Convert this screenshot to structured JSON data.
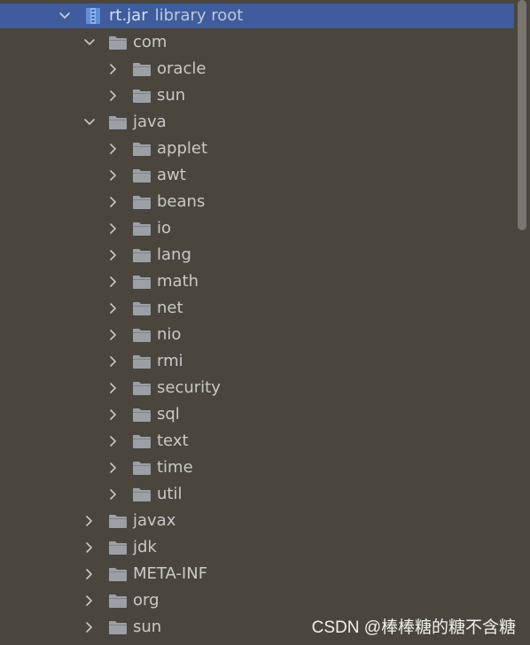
{
  "tree": {
    "root": {
      "label": "rt.jar",
      "secondary": "library root",
      "expanded": true
    },
    "items": [
      {
        "label": "com",
        "expanded": true,
        "depth": 1
      },
      {
        "label": "oracle",
        "expanded": false,
        "depth": 2
      },
      {
        "label": "sun",
        "expanded": false,
        "depth": 2
      },
      {
        "label": "java",
        "expanded": true,
        "depth": 1
      },
      {
        "label": "applet",
        "expanded": false,
        "depth": 2
      },
      {
        "label": "awt",
        "expanded": false,
        "depth": 2
      },
      {
        "label": "beans",
        "expanded": false,
        "depth": 2
      },
      {
        "label": "io",
        "expanded": false,
        "depth": 2
      },
      {
        "label": "lang",
        "expanded": false,
        "depth": 2
      },
      {
        "label": "math",
        "expanded": false,
        "depth": 2
      },
      {
        "label": "net",
        "expanded": false,
        "depth": 2
      },
      {
        "label": "nio",
        "expanded": false,
        "depth": 2
      },
      {
        "label": "rmi",
        "expanded": false,
        "depth": 2
      },
      {
        "label": "security",
        "expanded": false,
        "depth": 2
      },
      {
        "label": "sql",
        "expanded": false,
        "depth": 2
      },
      {
        "label": "text",
        "expanded": false,
        "depth": 2
      },
      {
        "label": "time",
        "expanded": false,
        "depth": 2
      },
      {
        "label": "util",
        "expanded": false,
        "depth": 2
      },
      {
        "label": "javax",
        "expanded": false,
        "depth": 1
      },
      {
        "label": "jdk",
        "expanded": false,
        "depth": 1
      },
      {
        "label": "META-INF",
        "expanded": false,
        "depth": 1
      },
      {
        "label": "org",
        "expanded": false,
        "depth": 1
      },
      {
        "label": "sun",
        "expanded": false,
        "depth": 1
      }
    ]
  },
  "watermark": "CSDN @棒棒糖的糖不含糖",
  "colors": {
    "background": "#4a463d",
    "selection": "#3f5d9e",
    "text": "#c9c9c9",
    "folder": "#9aa0a6"
  },
  "icons": {
    "expand": "chevron-down-icon",
    "collapse": "chevron-right-icon",
    "folder": "folder-icon",
    "jar": "jar-archive-icon"
  }
}
